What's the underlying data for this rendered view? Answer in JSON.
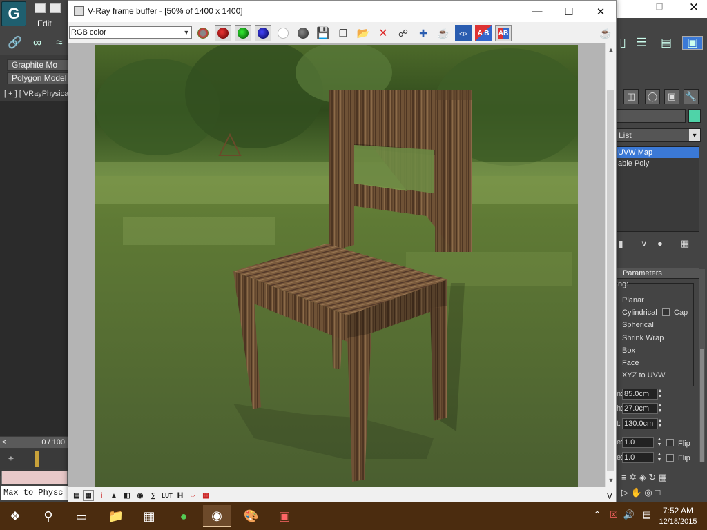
{
  "max": {
    "menu_edit": "Edit",
    "ribbon_graphite": "Graphite Mo",
    "ribbon_polygon": "Polygon Model",
    "viewport_label": "[ + ] [ VRayPhysica",
    "time_slider": "0 / 100",
    "mxs_text": "Max to Physc",
    "modifier_list": "List",
    "stack": [
      "UVW Map",
      "able Poly"
    ],
    "params_title": "Parameters",
    "mapping_label": "ng:",
    "mapping_options": [
      "Planar",
      "Cylindrical",
      "Spherical",
      "Shrink Wrap",
      "Box",
      "Face",
      "XYZ to UVW"
    ],
    "cap_label": "Cap",
    "length_label": "n:",
    "length_value": "85.0cm",
    "width_label": "h:",
    "width_value": "27.0cm",
    "height_label": "t:",
    "height_value": "130.0cm",
    "tile_u_label": "e:",
    "tile_u": "1.0",
    "tile_v_label": "e:",
    "tile_v": "1.0",
    "flip_label": "Flip",
    "colors": {
      "object_color": "#4fd3a8",
      "selection": "#3b79d6"
    }
  },
  "vfb": {
    "title": "V-Ray frame buffer - [50% of 1400 x 1400]",
    "channel": "RGB color",
    "buttons": [
      "color-wheel-icon",
      "red-channel",
      "green-channel",
      "blue-channel",
      "alpha-channel",
      "mono-channel",
      "save-icon",
      "save-all-icon",
      "load-icon",
      "clear-icon",
      "track-mouse-icon",
      "region-icon",
      "render-teapot-icon",
      "link-icon",
      "history-a-b-icon",
      "compare-a-b-icon",
      "teapot-render-icon"
    ]
  },
  "taskbar": {
    "time": "7:52 AM",
    "date": "12/18/2015"
  }
}
